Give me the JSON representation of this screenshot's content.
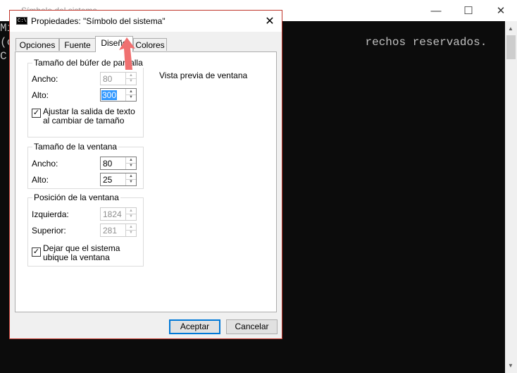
{
  "console": {
    "title": "Símbolo del sistema",
    "lines": [
      "Mi",
      "(c                                                    rechos reservados.",
      "",
      "C:"
    ],
    "caption_buttons": {
      "minimize": "—",
      "maximize": "☐",
      "close": "✕"
    }
  },
  "dialog": {
    "title": "Propiedades: \"Símbolo del sistema\"",
    "icon_text": "C:\\",
    "close": "✕",
    "tabs": [
      {
        "label": "Opciones",
        "active": false
      },
      {
        "label": "Fuente",
        "active": false
      },
      {
        "label": "Diseño",
        "active": true
      },
      {
        "label": "Colores",
        "active": false
      }
    ],
    "buffer_group": {
      "title": "Tamaño del búfer de pantalla",
      "width_label": "Ancho:",
      "width_value": "80",
      "height_label": "Alto:",
      "height_value": "300",
      "wrap_checked": "✓",
      "wrap_label": "Ajustar la salida de texto al cambiar de tamaño"
    },
    "window_size_group": {
      "title": "Tamaño de la ventana",
      "width_label": "Ancho:",
      "width_value": "80",
      "height_label": "Alto:",
      "height_value": "25"
    },
    "window_position_group": {
      "title": "Posición de la ventana",
      "left_label": "Izquierda:",
      "left_value": "1824",
      "top_label": "Superior:",
      "top_value": "281",
      "auto_checked": "✓",
      "auto_label": "Dejar que el sistema ubique la ventana"
    },
    "preview_label": "Vista previa de ventana",
    "ok_label": "Aceptar",
    "cancel_label": "Cancelar"
  },
  "colors": {
    "accent": "#0078d7",
    "arrow": "#f07070",
    "dialog_border": "#c0352b"
  }
}
